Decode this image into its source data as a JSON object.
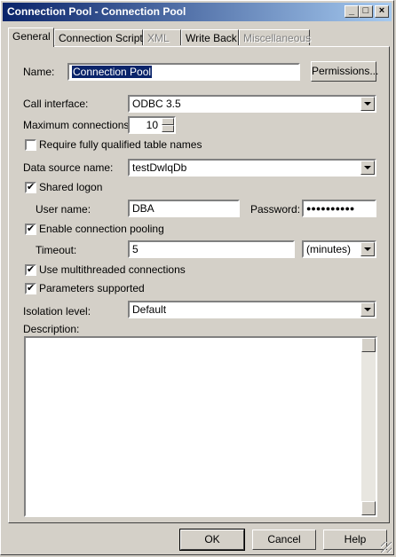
{
  "window": {
    "title": "Connection Pool - Connection Pool",
    "minimize": "_",
    "maximize": "□",
    "close": "×"
  },
  "tabs": [
    {
      "label": "General",
      "active": true,
      "disabled": false
    },
    {
      "label": "Connection Scripts",
      "active": false,
      "disabled": false
    },
    {
      "label": "XML",
      "active": false,
      "disabled": true
    },
    {
      "label": "Write Back",
      "active": false,
      "disabled": false
    },
    {
      "label": "Miscellaneous",
      "active": false,
      "disabled": true
    }
  ],
  "form": {
    "name_label": "Name:",
    "name_value": "Connection Pool",
    "permissions_button": "Permissions...",
    "call_interface_label": "Call interface:",
    "call_interface_value": "ODBC 3.5",
    "max_connections_label": "Maximum connections:",
    "max_connections_value": "10",
    "require_qualified_label": "Require fully qualified table names",
    "require_qualified_checked": false,
    "data_source_label": "Data source name:",
    "data_source_value": "testDwlqDb",
    "shared_logon_label": "Shared logon",
    "shared_logon_checked": true,
    "user_name_label": "User name:",
    "user_name_value": "DBA",
    "password_label": "Password:",
    "password_value": "●●●●●●●●●●",
    "enable_pooling_label": "Enable connection pooling",
    "enable_pooling_checked": true,
    "timeout_label": "Timeout:",
    "timeout_value": "5",
    "timeout_unit": "(minutes)",
    "multithreaded_label": "Use multithreaded connections",
    "multithreaded_checked": true,
    "params_supported_label": "Parameters supported",
    "params_supported_checked": true,
    "isolation_label": "Isolation level:",
    "isolation_value": "Default",
    "description_label": "Description:",
    "description_value": ""
  },
  "buttons": {
    "ok": "OK",
    "cancel": "Cancel",
    "help": "Help"
  }
}
